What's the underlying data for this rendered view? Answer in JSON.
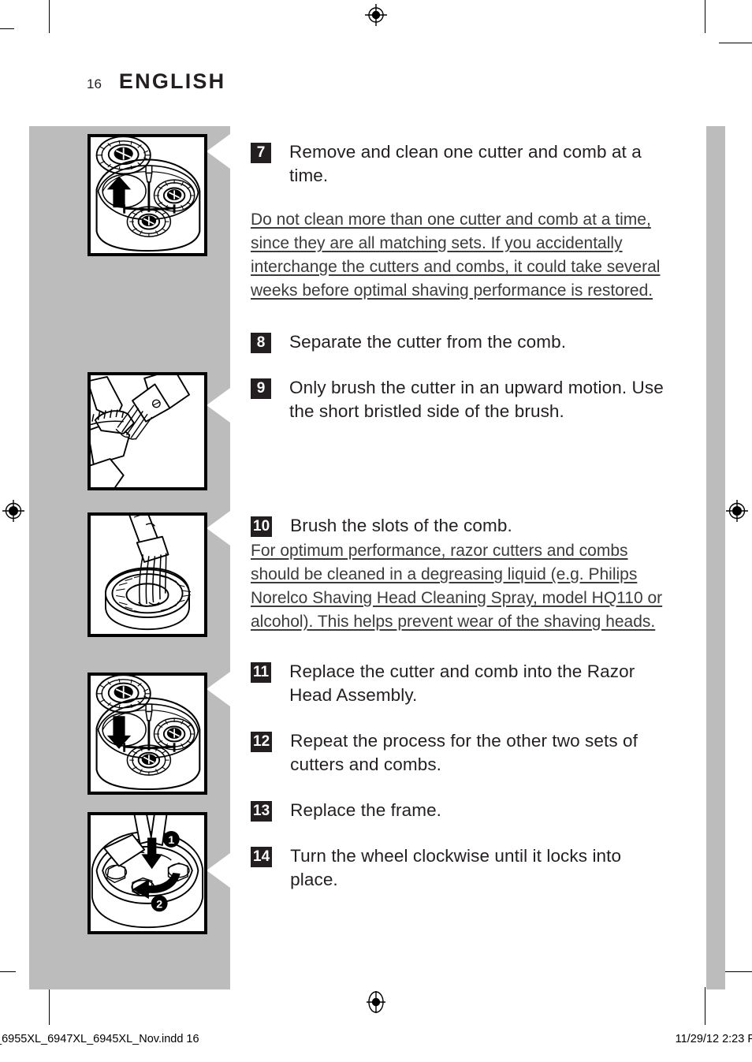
{
  "header": {
    "folio": "16",
    "language": "ENGLISH"
  },
  "steps": [
    {
      "number": "7",
      "text": "Remove and clean one cutter and comb at a time."
    },
    {
      "number": "8",
      "text": "Separate the cutter from the comb."
    },
    {
      "number": "9",
      "text": "Only brush the cutter in an upward motion. Use the short bristled side of the brush."
    },
    {
      "number": "10",
      "text": "Brush the slots of the comb."
    },
    {
      "number": "11",
      "text": "Replace the cutter and comb into the Razor Head Assembly."
    },
    {
      "number": "12",
      "text": "Repeat the process for the other two sets of cutters and combs."
    },
    {
      "number": "13",
      "text": "Replace the frame."
    },
    {
      "number": "14",
      "text": "Turn the wheel clockwise until it locks into place."
    }
  ],
  "notes": {
    "warning_after_7": "Do not clean more than one cutter and comb at a time, since they are all matching sets. If you accidentally interchange the cutters and combs, it could take several weeks before optimal shaving performance is restored.",
    "note_under_10": "For optimum performance, razor cutters and combs should be cleaned in a degreasing liquid (e.g. Philips Norelco Shaving Head Cleaning Spray, model HQ110 or alcohol).  This helps prevent wear of the shaving heads."
  },
  "figures": [
    {
      "name": "shaver-head-remove-cutter",
      "caption_ref": "7",
      "callouts": []
    },
    {
      "name": "brush-cutter-upward",
      "caption_ref": "9",
      "callouts": []
    },
    {
      "name": "brush-comb-slots",
      "caption_ref": "10",
      "callouts": []
    },
    {
      "name": "shaver-head-replace-cutter",
      "caption_ref": "11",
      "callouts": []
    },
    {
      "name": "replace-frame-turn-wheel",
      "caption_ref": "13",
      "callouts": [
        "1",
        "2"
      ]
    }
  ],
  "footer": {
    "filename": "_6955XL_6947XL_6945XL_Nov.indd   16",
    "timestamp": "11/29/12   2:23 P"
  },
  "colors": {
    "ink": "#231f20",
    "band_gray": "#bcbcbc",
    "paper": "#ffffff"
  }
}
